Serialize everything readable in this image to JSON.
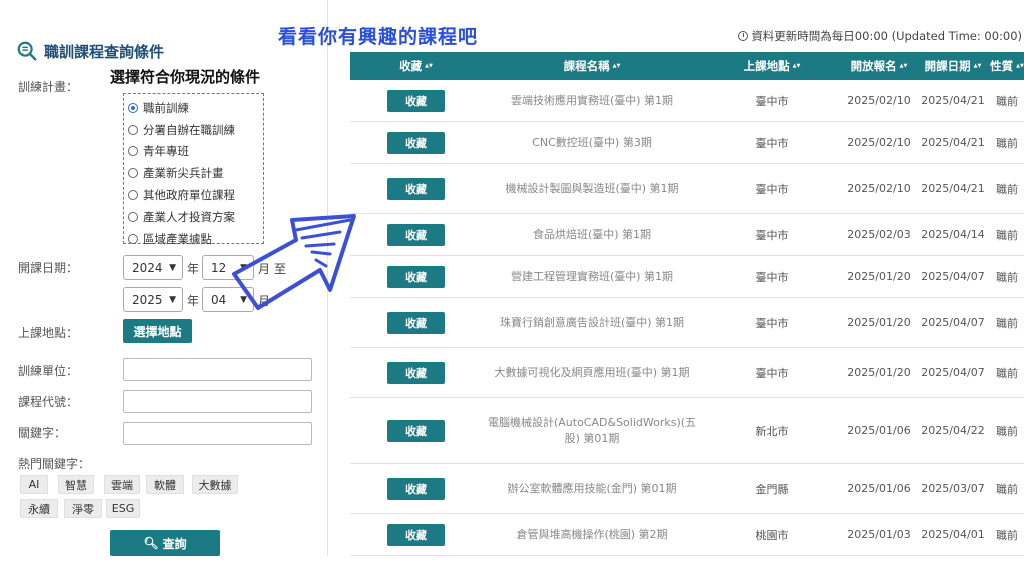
{
  "panel": {
    "title": "職訓課程查詢條件",
    "hint": "選擇符合你現況的條件",
    "plan_label": "訓練計畫：",
    "plans": [
      "職前訓練",
      "分署自辦在職訓練",
      "青年專班",
      "產業新尖兵計畫",
      "其他政府單位課程",
      "產業人才投資方案",
      "區域產業據點"
    ],
    "selected_plan": "職前訓練",
    "date_label": "開課日期：",
    "start": {
      "year": "2024",
      "year_unit": "年",
      "month": "12",
      "month_unit": "月",
      "to": "至"
    },
    "end": {
      "year": "2025",
      "year_unit": "年",
      "month": "04",
      "month_unit": "月"
    },
    "location_label": "上課地點：",
    "location_button": "選擇地點",
    "unit_label": "訓練單位：",
    "code_label": "課程代號：",
    "keyword_label": "關鍵字：",
    "hot_label": "熱門關鍵字：",
    "hot_tags": [
      "AI",
      "智慧",
      "雲端",
      "軟體",
      "大數據",
      "永續",
      "淨零",
      "ESG"
    ],
    "search_button": "查詢"
  },
  "headline": "看看你有興趣的課程吧",
  "update_text": "資料更新時間為每日00:00 (Updated Time: 00:00)",
  "table": {
    "headers": [
      "收藏",
      "課程名稱",
      "上課地點",
      "開放報名",
      "開課日期",
      "性質"
    ],
    "fav_label": "收藏",
    "rows": [
      {
        "name": "雲端技術應用實務班(臺中) 第1期",
        "location": "臺中市",
        "open": "2025/02/10",
        "start": "2025/04/21",
        "type": "職前"
      },
      {
        "name": "CNC數控班(臺中) 第3期",
        "location": "臺中市",
        "open": "2025/02/10",
        "start": "2025/04/21",
        "type": "職前"
      },
      {
        "name": "機械設計製圖與製造班(臺中) 第1期",
        "location": "臺中市",
        "open": "2025/02/10",
        "start": "2025/04/21",
        "type": "職前"
      },
      {
        "name": "食品烘焙班(臺中) 第1期",
        "location": "臺中市",
        "open": "2025/02/03",
        "start": "2025/04/14",
        "type": "職前"
      },
      {
        "name": "營建工程管理實務班(臺中) 第1期",
        "location": "臺中市",
        "open": "2025/01/20",
        "start": "2025/04/07",
        "type": "職前"
      },
      {
        "name": "珠寶行銷創意廣告設計班(臺中) 第1期",
        "location": "臺中市",
        "open": "2025/01/20",
        "start": "2025/04/07",
        "type": "職前"
      },
      {
        "name": "大數據可視化及網頁應用班(臺中) 第1期",
        "location": "臺中市",
        "open": "2025/01/20",
        "start": "2025/04/07",
        "type": "職前"
      },
      {
        "name": "電腦機械設計(AutoCAD&SolidWorks)(五股) 第01期",
        "location": "新北市",
        "open": "2025/01/06",
        "start": "2025/04/22",
        "type": "職前"
      },
      {
        "name": "辦公室軟體應用技能(金門) 第01期",
        "location": "金門縣",
        "open": "2025/01/06",
        "start": "2025/03/07",
        "type": "職前"
      },
      {
        "name": "倉管與堆高機操作(桃園) 第2期",
        "location": "桃園市",
        "open": "2025/01/03",
        "start": "2025/04/01",
        "type": "職前"
      }
    ]
  },
  "colors": {
    "teal": "#1c7a84",
    "title_blue": "#1f4e79",
    "headline_blue": "#2a4fd8",
    "arrow_blue": "#3b4fd8"
  }
}
